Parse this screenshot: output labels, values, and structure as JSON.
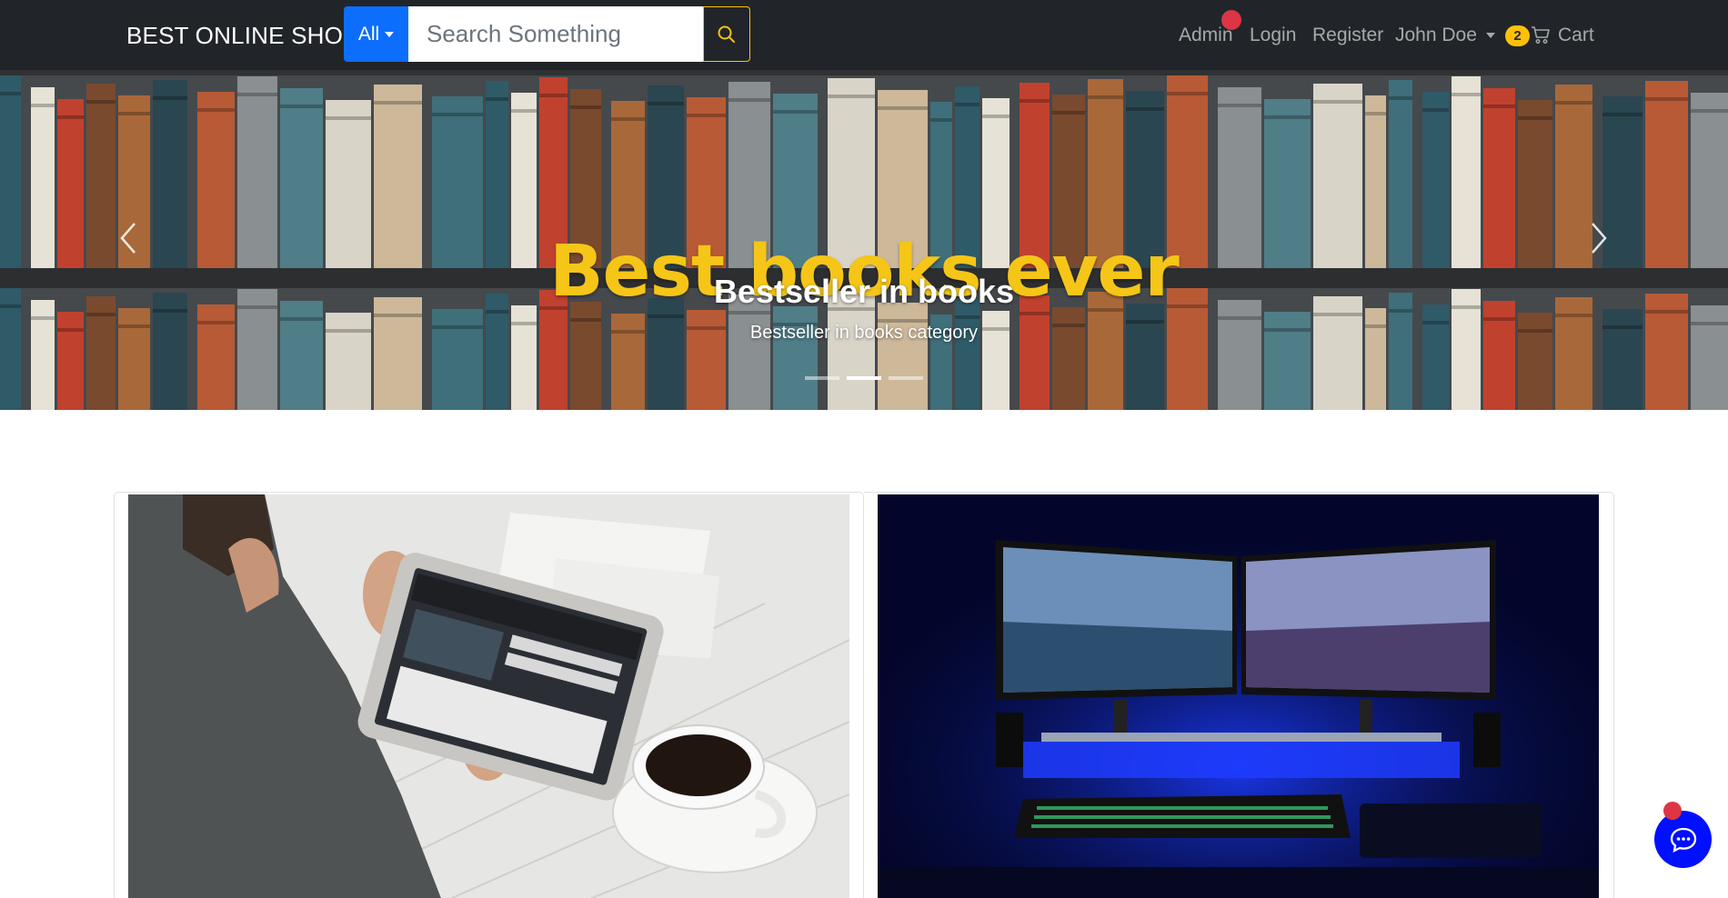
{
  "navbar": {
    "brand": "BEST ONLINE SHOP",
    "search": {
      "category": "All",
      "placeholder": "Search Something",
      "value": "",
      "button_icon": "search-icon"
    },
    "links": {
      "admin": "Admin",
      "login": "Login",
      "register": "Register",
      "user": "John Doe",
      "cart": "Cart"
    },
    "cart_count": "2",
    "cart_icon": "cart-icon"
  },
  "hero": {
    "banner_text": "Best books ever",
    "title": "Bestseller in books",
    "caption": "Bestseller in books category",
    "slides": 3,
    "active_slide": 2,
    "prev_icon": "chevron-left-icon",
    "next_icon": "chevron-right-icon"
  },
  "cards": [
    {
      "image": "person-using-tablet-with-coffee"
    },
    {
      "image": "dual-monitor-desk-setup-blue-light"
    }
  ],
  "chat": {
    "icon": "chat-bubble-icon"
  },
  "colors": {
    "navbar_bg": "#212529",
    "primary": "#0d6efd",
    "warning": "#ffc107",
    "danger": "#dc3545",
    "banner_text": "#f5c518",
    "chat_button": "#0010ff"
  }
}
